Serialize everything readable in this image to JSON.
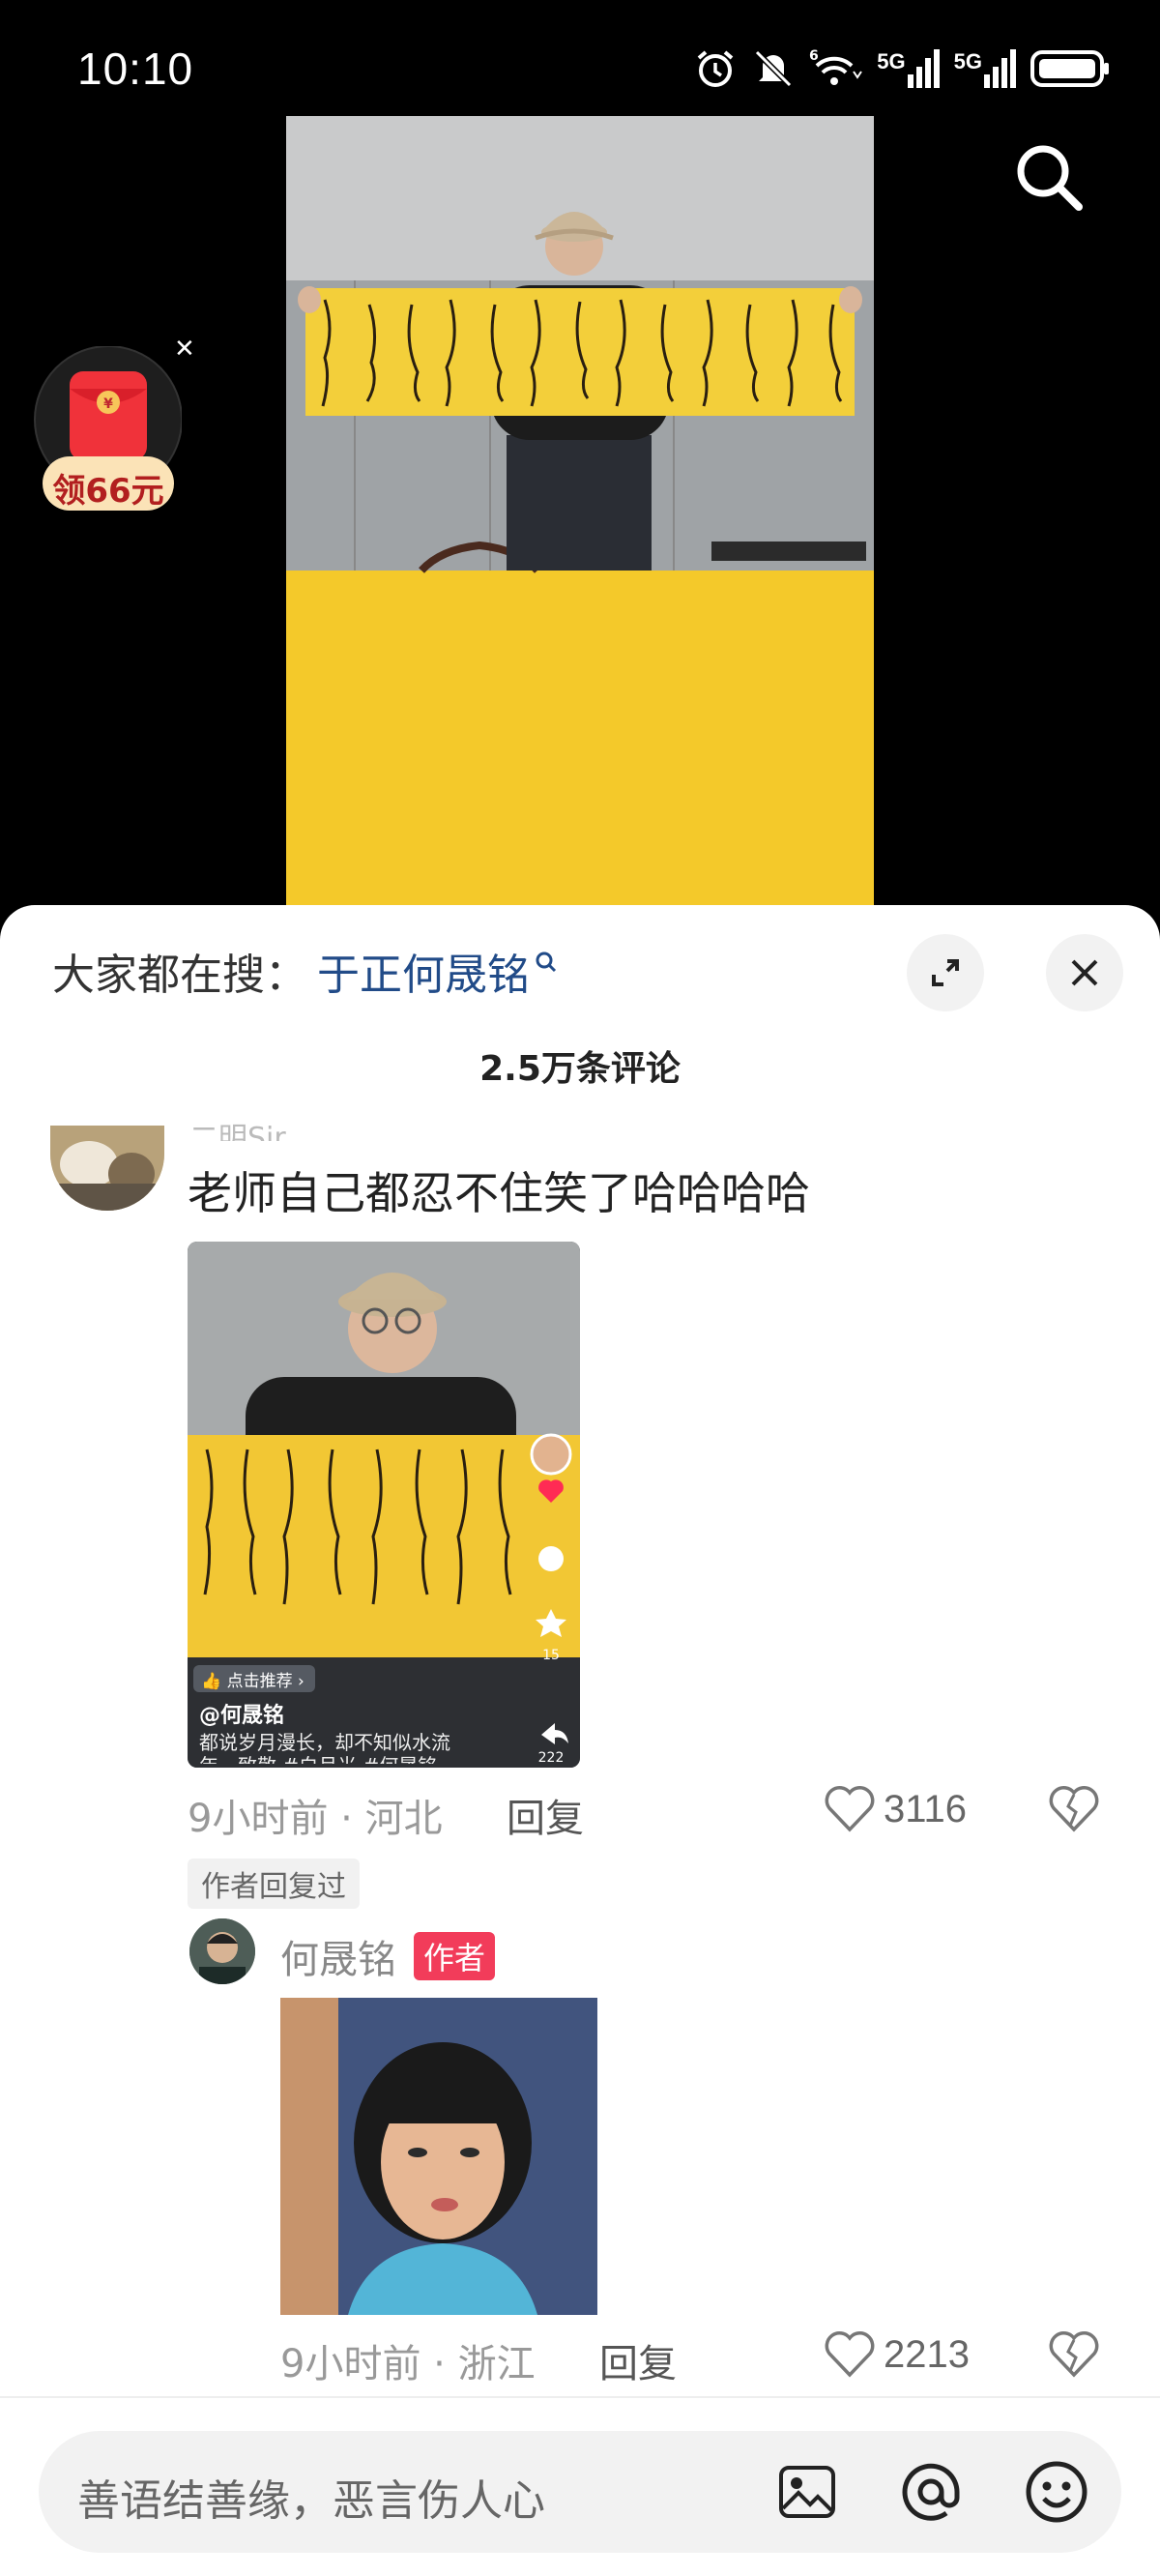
{
  "status_bar": {
    "time": "10:10",
    "net1": "5G",
    "net2": "5G",
    "wifi_badge": "6"
  },
  "red_packet": {
    "label": "领66元"
  },
  "hot_search": {
    "prefix": "大家都在搜：",
    "keyword": "于正何晟铭"
  },
  "comment_count": "2.5万条评论",
  "comment": {
    "username": "二明Sir",
    "text": "老师自己都忍不住笑了哈哈哈哈",
    "meta": "9小时前 · 河北",
    "reply_label": "回复",
    "likes": "3116",
    "author_replied_tag": "作者回复过",
    "thumb": {
      "recommend": "点击推荐",
      "handle": "@何晟铭",
      "caption": "都说岁月漫长，却不知似水流年，致敬 #白月光 #何晟铭",
      "count_star": "15",
      "count_share": "222"
    }
  },
  "reply": {
    "username": "何晟铭",
    "author_tag": "作者",
    "meta": "9小时前 · 浙江",
    "reply_label": "回复",
    "likes": "2213"
  },
  "input": {
    "placeholder": "善语结善缘，恶言伤人心"
  },
  "icons": [
    "alarm-icon",
    "mute-icon",
    "wifi-icon",
    "signal-icon",
    "battery-icon",
    "search-icon",
    "expand-icon",
    "close-icon",
    "heart-icon",
    "dislike-icon",
    "image-icon",
    "at-icon",
    "emoji-icon"
  ]
}
